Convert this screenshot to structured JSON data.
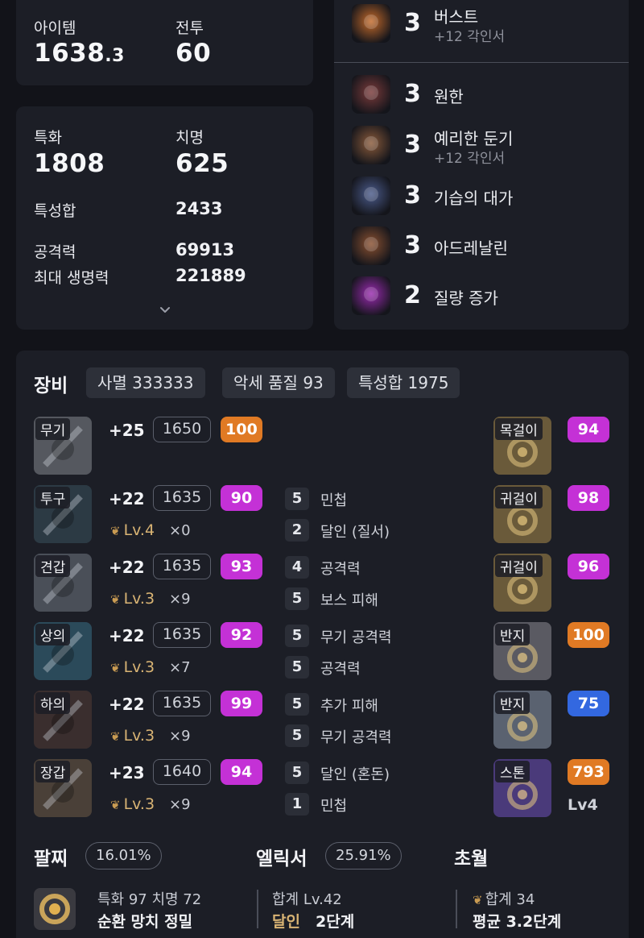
{
  "stats_top": {
    "item_label": "아이템",
    "item_main": "1638",
    "item_frac": ".3",
    "combat_label": "전투",
    "combat_value": "60"
  },
  "stats": {
    "spec_label": "특화",
    "spec_value": "1808",
    "crit_label": "치명",
    "crit_value": "625",
    "sum_label": "특성합",
    "sum_value": "2433",
    "atk_label": "공격력",
    "atk_value": "69913",
    "hp_label": "최대 생명력",
    "hp_value": "221889",
    "expand_icon": "chevron-down-icon"
  },
  "engravings": [
    {
      "level": "3",
      "name": "버스트",
      "sub": "+12 각인서",
      "icon": "burst-icon",
      "color": "#c46a2a"
    },
    {
      "level": "3",
      "name": "원한",
      "sub": "",
      "icon": "grudge-icon",
      "color": "#7a3a3a"
    },
    {
      "level": "3",
      "name": "예리한 둔기",
      "sub": "+12 각인서",
      "icon": "keen-blunt-icon",
      "color": "#8a5a3a"
    },
    {
      "level": "3",
      "name": "기습의 대가",
      "sub": "",
      "icon": "ambush-master-icon",
      "color": "#4a5a8a"
    },
    {
      "level": "3",
      "name": "아드레날린",
      "sub": "",
      "icon": "adrenaline-icon",
      "color": "#8a5030"
    },
    {
      "level": "2",
      "name": "질량 증가",
      "sub": "",
      "icon": "mass-increase-icon",
      "color": "#9a2ab0"
    }
  ],
  "equipment": {
    "title": "장비",
    "chips": [
      "사멸 333333",
      "악세 품질 93",
      "특성합 1975"
    ],
    "gear": [
      {
        "slot": "무기",
        "plus": "+25",
        "ilvl": "1650",
        "quality": "100",
        "qcolor": "orange",
        "tlv": "",
        "tx": "",
        "icon": "weapon-icon"
      },
      {
        "slot": "투구",
        "plus": "+22",
        "ilvl": "1635",
        "quality": "90",
        "qcolor": "purple",
        "tlv": "Lv.4",
        "tx": "×0",
        "icon": "helmet-icon"
      },
      {
        "slot": "견갑",
        "plus": "+22",
        "ilvl": "1635",
        "quality": "93",
        "qcolor": "purple",
        "tlv": "Lv.3",
        "tx": "×9",
        "icon": "shoulder-icon"
      },
      {
        "slot": "상의",
        "plus": "+22",
        "ilvl": "1635",
        "quality": "92",
        "qcolor": "purple",
        "tlv": "Lv.3",
        "tx": "×7",
        "icon": "chest-icon"
      },
      {
        "slot": "하의",
        "plus": "+22",
        "ilvl": "1635",
        "quality": "99",
        "qcolor": "purple",
        "tlv": "Lv.3",
        "tx": "×9",
        "icon": "pants-icon"
      },
      {
        "slot": "장갑",
        "plus": "+23",
        "ilvl": "1640",
        "quality": "94",
        "qcolor": "purple",
        "tlv": "Lv.3",
        "tx": "×9",
        "icon": "gloves-icon"
      }
    ],
    "stones": [
      {
        "n": "5",
        "label": "민첩"
      },
      {
        "n": "2",
        "label": "달인 (질서)"
      },
      {
        "n": "4",
        "label": "공격력"
      },
      {
        "n": "5",
        "label": "보스 피해"
      },
      {
        "n": "5",
        "label": "무기 공격력"
      },
      {
        "n": "5",
        "label": "공격력"
      },
      {
        "n": "5",
        "label": "추가 피해"
      },
      {
        "n": "5",
        "label": "무기 공격력"
      },
      {
        "n": "5",
        "label": "달인 (혼돈)"
      },
      {
        "n": "1",
        "label": "민첩"
      }
    ],
    "accessories": [
      {
        "slot": "목걸이",
        "quality": "94",
        "qcolor": "purple",
        "icon": "necklace-icon",
        "extra": ""
      },
      {
        "slot": "귀걸이",
        "quality": "98",
        "qcolor": "purple",
        "icon": "earring-icon",
        "extra": ""
      },
      {
        "slot": "귀걸이",
        "quality": "96",
        "qcolor": "purple",
        "icon": "earring-icon",
        "extra": ""
      },
      {
        "slot": "반지",
        "quality": "100",
        "qcolor": "orange",
        "icon": "ring-icon",
        "extra": ""
      },
      {
        "slot": "반지",
        "quality": "75",
        "qcolor": "blue",
        "icon": "ring-icon",
        "extra": ""
      },
      {
        "slot": "스톤",
        "quality": "793",
        "qcolor": "orange",
        "icon": "ability-stone-icon",
        "extra": "Lv4"
      }
    ]
  },
  "bracelet": {
    "title": "팔찌",
    "pct": "16.01%",
    "line1": "특화 97  치명 72",
    "line2": "순환  망치  정밀",
    "icon": "bracelet-icon"
  },
  "elixir": {
    "title": "엘릭서",
    "pct": "25.91%",
    "line1": "합계 Lv.42",
    "line2_a": "달인",
    "line2_b": "2단계"
  },
  "transcend": {
    "title": "초월",
    "line1": "합계 34",
    "line2": "평균 3.2단계",
    "icon": "transcend-leaf-icon"
  },
  "colors": {
    "accent_gold": "#d9b474",
    "quality_purple": "#c431d6",
    "quality_orange": "#e07a24",
    "quality_blue": "#3368e0"
  }
}
